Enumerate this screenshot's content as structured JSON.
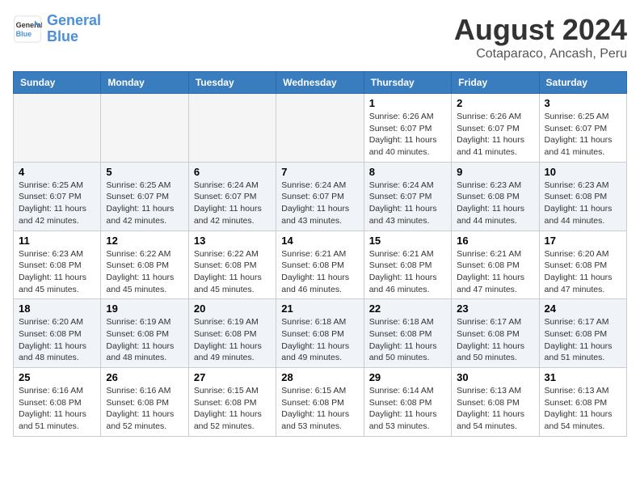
{
  "logo": {
    "line1": "General",
    "line2": "Blue"
  },
  "title": "August 2024",
  "subtitle": "Cotaparaco, Ancash, Peru",
  "headers": [
    "Sunday",
    "Monday",
    "Tuesday",
    "Wednesday",
    "Thursday",
    "Friday",
    "Saturday"
  ],
  "weeks": [
    [
      {
        "date": "",
        "info": ""
      },
      {
        "date": "",
        "info": ""
      },
      {
        "date": "",
        "info": ""
      },
      {
        "date": "",
        "info": ""
      },
      {
        "date": "1",
        "info": "Sunrise: 6:26 AM\nSunset: 6:07 PM\nDaylight: 11 hours and 40 minutes."
      },
      {
        "date": "2",
        "info": "Sunrise: 6:26 AM\nSunset: 6:07 PM\nDaylight: 11 hours and 41 minutes."
      },
      {
        "date": "3",
        "info": "Sunrise: 6:25 AM\nSunset: 6:07 PM\nDaylight: 11 hours and 41 minutes."
      }
    ],
    [
      {
        "date": "4",
        "info": "Sunrise: 6:25 AM\nSunset: 6:07 PM\nDaylight: 11 hours and 42 minutes."
      },
      {
        "date": "5",
        "info": "Sunrise: 6:25 AM\nSunset: 6:07 PM\nDaylight: 11 hours and 42 minutes."
      },
      {
        "date": "6",
        "info": "Sunrise: 6:24 AM\nSunset: 6:07 PM\nDaylight: 11 hours and 42 minutes."
      },
      {
        "date": "7",
        "info": "Sunrise: 6:24 AM\nSunset: 6:07 PM\nDaylight: 11 hours and 43 minutes."
      },
      {
        "date": "8",
        "info": "Sunrise: 6:24 AM\nSunset: 6:07 PM\nDaylight: 11 hours and 43 minutes."
      },
      {
        "date": "9",
        "info": "Sunrise: 6:23 AM\nSunset: 6:08 PM\nDaylight: 11 hours and 44 minutes."
      },
      {
        "date": "10",
        "info": "Sunrise: 6:23 AM\nSunset: 6:08 PM\nDaylight: 11 hours and 44 minutes."
      }
    ],
    [
      {
        "date": "11",
        "info": "Sunrise: 6:23 AM\nSunset: 6:08 PM\nDaylight: 11 hours and 45 minutes."
      },
      {
        "date": "12",
        "info": "Sunrise: 6:22 AM\nSunset: 6:08 PM\nDaylight: 11 hours and 45 minutes."
      },
      {
        "date": "13",
        "info": "Sunrise: 6:22 AM\nSunset: 6:08 PM\nDaylight: 11 hours and 45 minutes."
      },
      {
        "date": "14",
        "info": "Sunrise: 6:21 AM\nSunset: 6:08 PM\nDaylight: 11 hours and 46 minutes."
      },
      {
        "date": "15",
        "info": "Sunrise: 6:21 AM\nSunset: 6:08 PM\nDaylight: 11 hours and 46 minutes."
      },
      {
        "date": "16",
        "info": "Sunrise: 6:21 AM\nSunset: 6:08 PM\nDaylight: 11 hours and 47 minutes."
      },
      {
        "date": "17",
        "info": "Sunrise: 6:20 AM\nSunset: 6:08 PM\nDaylight: 11 hours and 47 minutes."
      }
    ],
    [
      {
        "date": "18",
        "info": "Sunrise: 6:20 AM\nSunset: 6:08 PM\nDaylight: 11 hours and 48 minutes."
      },
      {
        "date": "19",
        "info": "Sunrise: 6:19 AM\nSunset: 6:08 PM\nDaylight: 11 hours and 48 minutes."
      },
      {
        "date": "20",
        "info": "Sunrise: 6:19 AM\nSunset: 6:08 PM\nDaylight: 11 hours and 49 minutes."
      },
      {
        "date": "21",
        "info": "Sunrise: 6:18 AM\nSunset: 6:08 PM\nDaylight: 11 hours and 49 minutes."
      },
      {
        "date": "22",
        "info": "Sunrise: 6:18 AM\nSunset: 6:08 PM\nDaylight: 11 hours and 50 minutes."
      },
      {
        "date": "23",
        "info": "Sunrise: 6:17 AM\nSunset: 6:08 PM\nDaylight: 11 hours and 50 minutes."
      },
      {
        "date": "24",
        "info": "Sunrise: 6:17 AM\nSunset: 6:08 PM\nDaylight: 11 hours and 51 minutes."
      }
    ],
    [
      {
        "date": "25",
        "info": "Sunrise: 6:16 AM\nSunset: 6:08 PM\nDaylight: 11 hours and 51 minutes."
      },
      {
        "date": "26",
        "info": "Sunrise: 6:16 AM\nSunset: 6:08 PM\nDaylight: 11 hours and 52 minutes."
      },
      {
        "date": "27",
        "info": "Sunrise: 6:15 AM\nSunset: 6:08 PM\nDaylight: 11 hours and 52 minutes."
      },
      {
        "date": "28",
        "info": "Sunrise: 6:15 AM\nSunset: 6:08 PM\nDaylight: 11 hours and 53 minutes."
      },
      {
        "date": "29",
        "info": "Sunrise: 6:14 AM\nSunset: 6:08 PM\nDaylight: 11 hours and 53 minutes."
      },
      {
        "date": "30",
        "info": "Sunrise: 6:13 AM\nSunset: 6:08 PM\nDaylight: 11 hours and 54 minutes."
      },
      {
        "date": "31",
        "info": "Sunrise: 6:13 AM\nSunset: 6:08 PM\nDaylight: 11 hours and 54 minutes."
      }
    ]
  ]
}
